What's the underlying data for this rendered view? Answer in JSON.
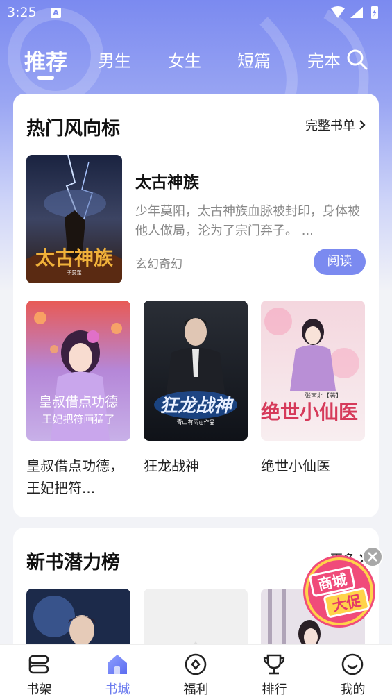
{
  "status_bar": {
    "time": "3:25",
    "badge": "A"
  },
  "tabs": [
    {
      "label": "推荐",
      "active": true
    },
    {
      "label": "男生",
      "active": false
    },
    {
      "label": "女生",
      "active": false
    },
    {
      "label": "短篇",
      "active": false
    },
    {
      "label": "完本",
      "active": false
    }
  ],
  "hot": {
    "title": "热门风向标",
    "more_label": "完整书单",
    "featured": {
      "title": "太古神族",
      "description": "少年莫阳，太古神族血脉被封印，身体被他人做局，沦为了宗门弃子。 ...",
      "genre": "玄幻奇幻",
      "read_label": "阅读",
      "cover_text": "太古神族",
      "cover_author": "子莫漾"
    },
    "books": [
      {
        "title": "皇叔借点功德，王妃把符...",
        "cover_text": "皇叔借点功德",
        "cover_sub": "王妃把符画猛了"
      },
      {
        "title": "狂龙战神",
        "cover_text": "狂龙战神",
        "cover_sub": "青山有雨◎作品"
      },
      {
        "title": "绝世小仙医",
        "cover_text": "绝世小仙医",
        "cover_sub": "张南北【著】"
      }
    ]
  },
  "newbooks": {
    "title": "新书潜力榜",
    "more_label": "更多"
  },
  "promo": {
    "line1": "商城",
    "line2": "大促"
  },
  "bottom_nav": [
    {
      "label": "书架",
      "icon": "bookshelf-icon",
      "active": false
    },
    {
      "label": "书城",
      "icon": "bookstore-icon",
      "active": true
    },
    {
      "label": "福利",
      "icon": "welfare-icon",
      "active": false
    },
    {
      "label": "排行",
      "icon": "trophy-icon",
      "active": false
    },
    {
      "label": "我的",
      "icon": "profile-icon",
      "active": false
    }
  ],
  "colors": {
    "accent": "#7b8af0",
    "nav_active": "#6b7bef"
  }
}
